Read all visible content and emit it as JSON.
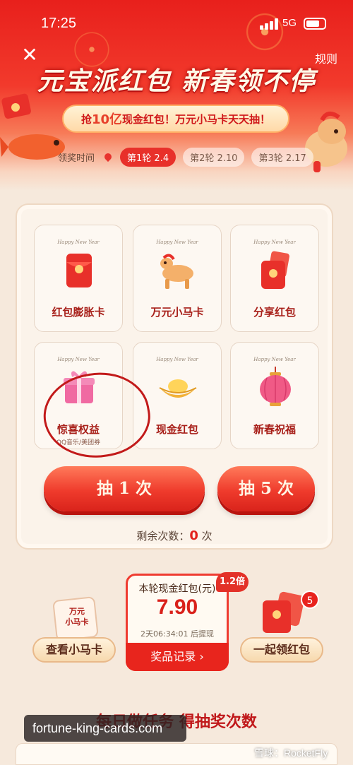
{
  "status_bar": {
    "time": "17:25",
    "network": "5G"
  },
  "header": {
    "close_icon": "close-icon",
    "rules_label": "规则",
    "title": "元宝派红包 新春领不停",
    "banner_prefix": "抢",
    "banner_highlight": "10亿",
    "banner_suffix": "现金红包！万元小马卡天天抽！",
    "schedule_label": "领奖时间",
    "rounds": [
      {
        "label": "第1轮 2.4",
        "active": true
      },
      {
        "label": "第2轮 2.10",
        "active": false
      },
      {
        "label": "第3轮 2.17",
        "active": false
      }
    ]
  },
  "prizes": [
    {
      "label": "红包膨胀卡",
      "subtitle": "",
      "icon": "red-envelope-icon",
      "tag": "Happy New Year"
    },
    {
      "label": "万元小马卡",
      "subtitle": "",
      "icon": "toy-horse-icon",
      "tag": "Happy New Year"
    },
    {
      "label": "分享红包",
      "subtitle": "",
      "icon": "share-red-envelope-icon",
      "tag": "Happy New Year"
    },
    {
      "label": "惊喜权益",
      "subtitle": "QQ音乐/美团券",
      "icon": "gift-box-icon",
      "tag": "Happy New Year"
    },
    {
      "label": "现金红包",
      "subtitle": "",
      "icon": "gold-ingot-icon",
      "tag": "Happy New Year"
    },
    {
      "label": "新春祝福",
      "subtitle": "",
      "icon": "lantern-icon",
      "tag": "Happy New Year"
    }
  ],
  "draw": {
    "draw_once": "抽 1 次",
    "draw_five": "抽 5 次",
    "remaining_label": "剩余次数：",
    "remaining_value": "0",
    "remaining_unit": "次"
  },
  "rewards": {
    "horse_card_text": "万元\n小马卡",
    "view_horse_card": "查看小马卡",
    "round_cash_title": "本轮现金红包(元)",
    "multiplier": "1.2倍",
    "amount": "7.90",
    "countdown": "2天06:34:01 后提现",
    "records_button": "奖品记录 ›",
    "share_badge": "5",
    "share_together": "一起领红包"
  },
  "tasks": {
    "title": "每日做任务 得抽奖次数"
  },
  "overlay": {
    "url": "fortune-king-cards.com",
    "watermark": "雪球：RocketFly"
  },
  "colors": {
    "primary_red": "#e8251d",
    "gold": "#ffd9a8",
    "background": "#f6e9dc"
  }
}
